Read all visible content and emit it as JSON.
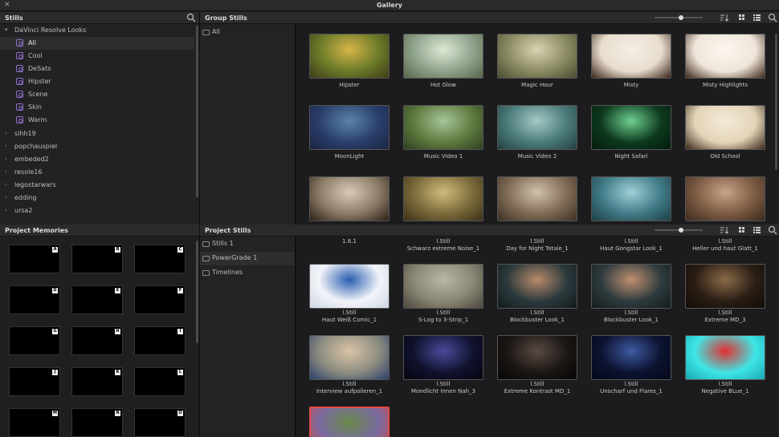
{
  "window": {
    "title": "Gallery",
    "close_glyph": "×"
  },
  "stills_panel": {
    "title": "Stills",
    "items": [
      {
        "label": "DaVinci Resolve Looks",
        "expanded": true
      },
      {
        "label": "All",
        "selected": true
      },
      {
        "label": "Cool"
      },
      {
        "label": "DeSats"
      },
      {
        "label": "Hipster"
      },
      {
        "label": "Scene"
      },
      {
        "label": "Skin"
      },
      {
        "label": "Warm"
      },
      {
        "label": "sihh19"
      },
      {
        "label": "popchauspiel"
      },
      {
        "label": "embeded2"
      },
      {
        "label": "resole16"
      },
      {
        "label": "legostarwars"
      },
      {
        "label": "edding"
      },
      {
        "label": "ursa2"
      }
    ]
  },
  "group_stills": {
    "title": "Group Stills",
    "side_items": [
      {
        "label": "All"
      }
    ],
    "thumbs": [
      {
        "label": "Hipster",
        "c1": "#6b7a28",
        "c2": "#d6b54a",
        "c3": "#3e3a18"
      },
      {
        "label": "Hot Glow",
        "c1": "#8ea38b",
        "c2": "#dfe8d4",
        "c3": "#59654a"
      },
      {
        "label": "Magic Hour",
        "c1": "#8a8a62",
        "c2": "#d9d3b3",
        "c3": "#4b4b32"
      },
      {
        "label": "Misty",
        "c1": "#e8ddcd",
        "c2": "#f4eee6",
        "c3": "#3a2418"
      },
      {
        "label": "Misty Highlights",
        "c1": "#efe6d9",
        "c2": "#fbf6ef",
        "c3": "#3d2619"
      },
      {
        "label": "MoonLight",
        "c1": "#2a3e6b",
        "c2": "#5a84a8",
        "c3": "#1a2440"
      },
      {
        "label": "Music Video 1",
        "c1": "#5d7a3e",
        "c2": "#a6c49a",
        "c3": "#2e3e22"
      },
      {
        "label": "Music Video 2",
        "c1": "#4b7a7a",
        "c2": "#a3c9c6",
        "c3": "#23403f"
      },
      {
        "label": "Night Safari",
        "c1": "#0d3a1e",
        "c2": "#6fcf90",
        "c3": "#051a0d"
      },
      {
        "label": "Old School",
        "c1": "#e3d4b8",
        "c2": "#f4ead8",
        "c3": "#3a2718"
      },
      {
        "label": "",
        "c1": "#8a7a66",
        "c2": "#d8cbb8",
        "c3": "#2c2016"
      },
      {
        "label": "",
        "c1": "#7a6a3a",
        "c2": "#cfbb7c",
        "c3": "#3a3018"
      },
      {
        "label": "",
        "c1": "#7e6b55",
        "c2": "#d2c2a8",
        "c3": "#3c2f22"
      },
      {
        "label": "",
        "c1": "#3f7a86",
        "c2": "#9fd0d8",
        "c3": "#1f3e44"
      },
      {
        "label": "",
        "c1": "#7a5a42",
        "c2": "#c7a48a",
        "c3": "#3a2a1e"
      }
    ]
  },
  "memories_panel": {
    "title": "Project Memories",
    "tags": [
      "A",
      "B",
      "C",
      "D",
      "E",
      "F",
      "G",
      "H",
      "I",
      "J",
      "K",
      "L",
      "M",
      "N",
      "O"
    ]
  },
  "project_stills": {
    "title": "Project Stills",
    "side_items": [
      {
        "label": "Stills 1"
      },
      {
        "label": "PowerGrade 1",
        "selected": true
      },
      {
        "label": "Timelines"
      }
    ],
    "top_row": [
      {
        "l1": "1.8.1",
        "l2": ""
      },
      {
        "l1": "l.Still",
        "l2": "Schwarz extreme Noise_1"
      },
      {
        "l1": "l.Still",
        "l2": "Day for Night Totale_1"
      },
      {
        "l1": "l.Still",
        "l2": "Haut Gongstar Look_1"
      },
      {
        "l1": "l.Still",
        "l2": "Heller und haut Glatt_1"
      }
    ],
    "thumbs": [
      {
        "l1": "l.Still",
        "l2": "Haut Weiß Comic_1",
        "c1": "#f2f4f8",
        "c2": "#2a5db0",
        "c3": "#cfd6e4"
      },
      {
        "l1": "l.Still",
        "l2": "S-Log to 3-Strip_1",
        "c1": "#8a8674",
        "c2": "#b9b6a6",
        "c3": "#4a473c"
      },
      {
        "l1": "l.Still",
        "l2": "Blockbuster Look_1",
        "c1": "#2c3a3d",
        "c2": "#b98a6a",
        "c3": "#121a1c"
      },
      {
        "l1": "l.Still",
        "l2": "Blockbuster Look_1",
        "c1": "#2e3b3e",
        "c2": "#c09070",
        "c3": "#141b1d"
      },
      {
        "l1": "l.Still",
        "l2": "Extreme MD_3",
        "c1": "#2a1e14",
        "c2": "#8a6a48",
        "c3": "#110b06"
      },
      {
        "l1": "l.Still",
        "l2": "Interview aufpolieren_1",
        "c1": "#8c8c80",
        "c2": "#d9c3a6",
        "c3": "#2c3f6a"
      },
      {
        "l1": "l.Still",
        "l2": "Mondlicht Innen Nah_3",
        "c1": "#10122e",
        "c2": "#4a4a9a",
        "c3": "#05060f"
      },
      {
        "l1": "l.Still",
        "l2": "Extreme Kontrast MD_1",
        "c1": "#1a1614",
        "c2": "#5a4a42",
        "c3": "#070605"
      },
      {
        "l1": "l.Still",
        "l2": "Unscharf und Flares_1",
        "c1": "#0c1230",
        "c2": "#3e5aa0",
        "c3": "#05081a"
      },
      {
        "l1": "l.Still",
        "l2": "Negative BLue_1",
        "c1": "#3ee6e6",
        "c2": "#e23030",
        "c3": "#1aa8b0"
      },
      {
        "l1": "",
        "l2": "",
        "c1": "#7a6aa0",
        "c2": "#6a8a4a",
        "c3": "#c84a4a"
      }
    ]
  }
}
